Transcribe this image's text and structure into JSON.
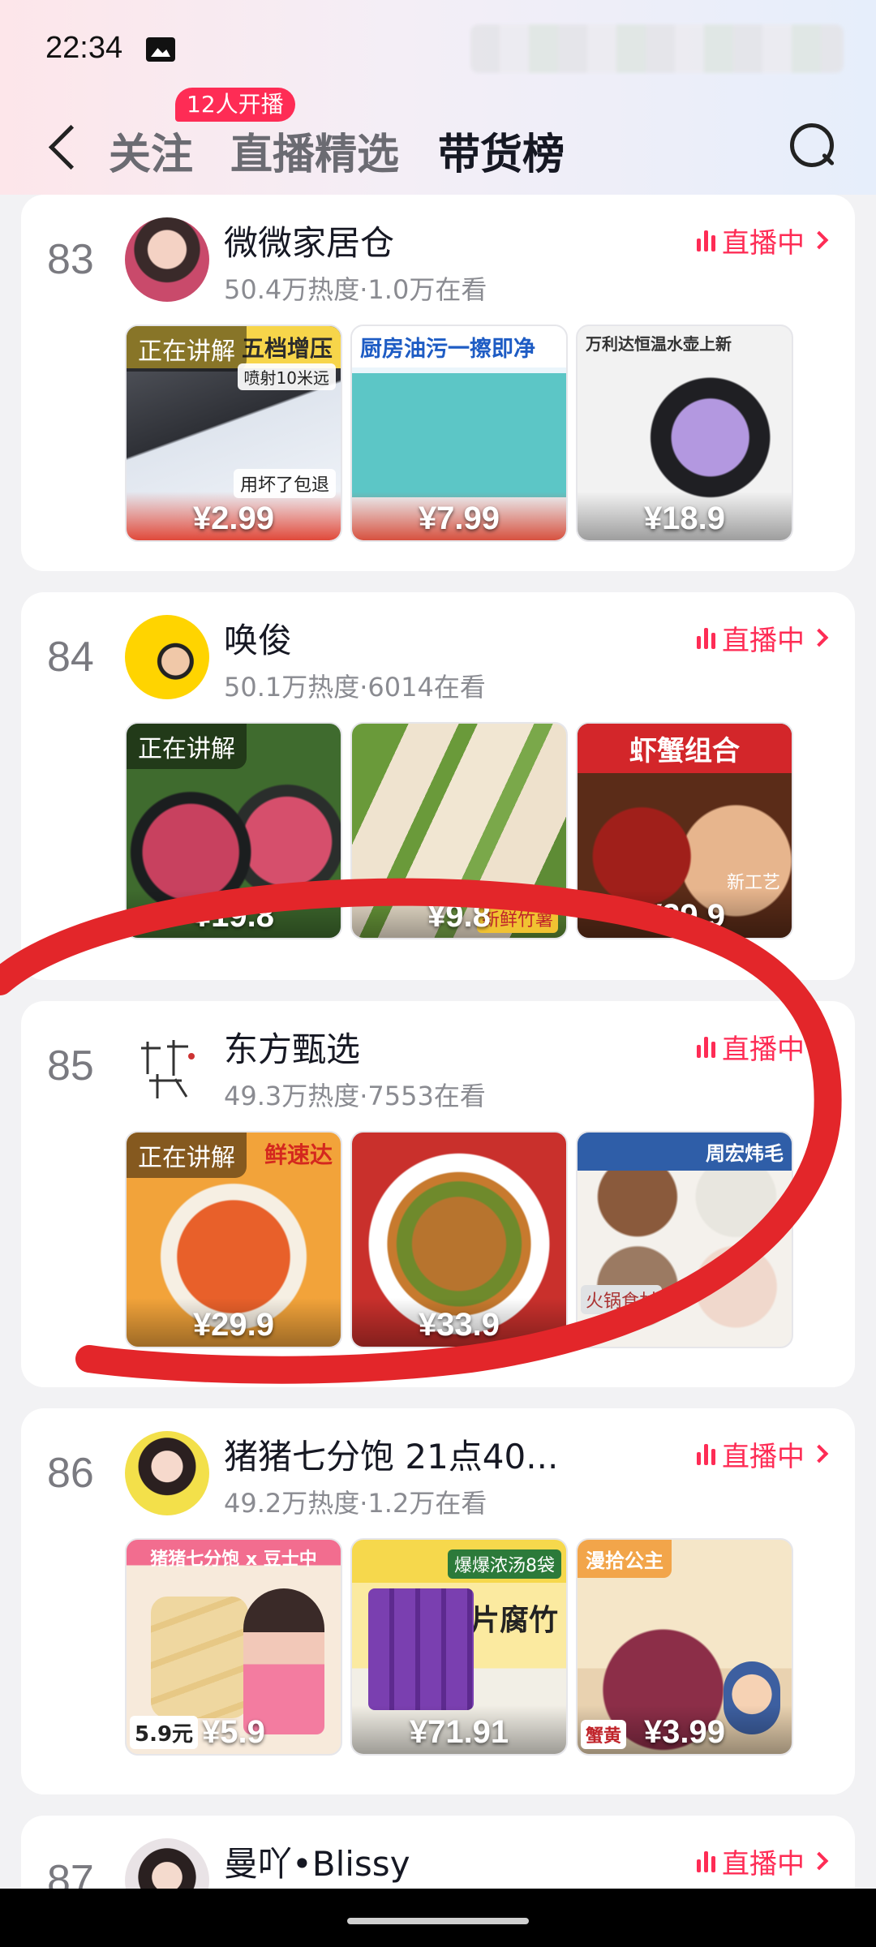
{
  "status": {
    "time": "22:34"
  },
  "nav": {
    "tabs": [
      {
        "label": "关注"
      },
      {
        "label": "直播精选"
      },
      {
        "label": "带货榜"
      }
    ],
    "badge": "12人开播"
  },
  "colors": {
    "accent": "#fe2c55",
    "annotation": "#e3262a"
  },
  "streamers": [
    {
      "rank": "83",
      "name": "微微家居仓",
      "meta": "50.4万热度·1.0万在看",
      "live_label": "直播中",
      "products": [
        {
          "title": "五档增压",
          "explaining": "正在讲解",
          "price": "¥2.99",
          "note": "用坏了包退",
          "note2": "喷射10米远"
        },
        {
          "title": "厨房油污一擦即净",
          "price": "¥7.99"
        },
        {
          "title": "万利达恒温水壶上新",
          "price": "¥18.9"
        }
      ]
    },
    {
      "rank": "84",
      "name": "唤俊",
      "meta": "50.1万热度·6014在看",
      "live_label": "直播中",
      "products": [
        {
          "explaining": "正在讲解",
          "price": "¥19.8"
        },
        {
          "price": "¥9.8",
          "note2": "新鲜竹薯"
        },
        {
          "title": "虾蟹组合",
          "price": "¥29.9",
          "note": "新工艺"
        }
      ]
    },
    {
      "rank": "85",
      "name": "东方甄选",
      "meta": "49.3万热度·7553在看",
      "live_label": "直播中",
      "products": [
        {
          "title": "鲜速达",
          "explaining": "正在讲解",
          "price": "¥29.9"
        },
        {
          "price": "¥33.9"
        },
        {
          "title": "周宏炜毛",
          "price": "",
          "note2": "火锅食材"
        }
      ]
    },
    {
      "rank": "86",
      "name": "猪猪七分饱 21点40...",
      "meta": "49.2万热度·1.2万在看",
      "live_label": "直播中",
      "products": [
        {
          "title": "猪猪七分饱 x 豆士中",
          "price": "¥5.9",
          "note2": "5.9元"
        },
        {
          "title": "大片腐竹",
          "price": "¥71.91",
          "note": "爆爆浓汤8袋"
        },
        {
          "title": "漫拾公主",
          "price": "¥3.99",
          "note2": "蟹黄"
        }
      ]
    },
    {
      "rank": "87",
      "name": "曼吖•Blissy",
      "live_label": "直播中"
    }
  ]
}
